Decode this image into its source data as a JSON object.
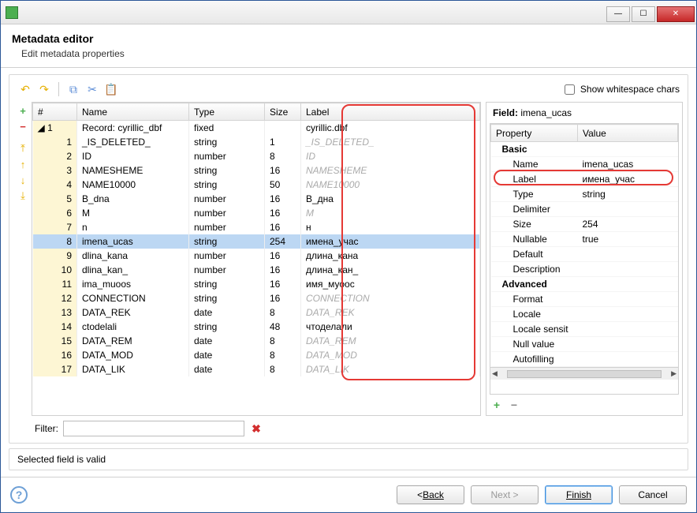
{
  "window": {
    "title": ""
  },
  "header": {
    "title": "Metadata editor",
    "subtitle": "Edit metadata properties"
  },
  "toolbar": {
    "show_ws_label": "Show whitespace chars",
    "show_ws_checked": false
  },
  "columns": {
    "idx": "#",
    "name": "Name",
    "type": "Type",
    "size": "Size",
    "label": "Label"
  },
  "rows": [
    {
      "idx": "1",
      "expander": true,
      "name": "Record: cyrillic_dbf",
      "type": "fixed",
      "size": "",
      "label": "cyrillic.dbf",
      "gray": false
    },
    {
      "idx": "1",
      "name": "_IS_DELETED_",
      "type": "string",
      "size": "1",
      "label": "_IS_DELETED_",
      "gray": true
    },
    {
      "idx": "2",
      "name": "ID",
      "type": "number",
      "size": "8",
      "label": "ID",
      "gray": true
    },
    {
      "idx": "3",
      "name": "NAMESHEME",
      "type": "string",
      "size": "16",
      "label": "NAMESHEME",
      "gray": true
    },
    {
      "idx": "4",
      "name": "NAME10000",
      "type": "string",
      "size": "50",
      "label": "NAME10000",
      "gray": true
    },
    {
      "idx": "5",
      "name": "B_dna",
      "type": "number",
      "size": "16",
      "label": "В_дна",
      "gray": false
    },
    {
      "idx": "6",
      "name": "M",
      "type": "number",
      "size": "16",
      "label": "М",
      "gray": true
    },
    {
      "idx": "7",
      "name": "n",
      "type": "number",
      "size": "16",
      "label": "н",
      "gray": false
    },
    {
      "idx": "8",
      "name": "imena_ucas",
      "type": "string",
      "size": "254",
      "label": "имена_учас",
      "gray": false,
      "selected": true
    },
    {
      "idx": "9",
      "name": "dlina_kana",
      "type": "number",
      "size": "16",
      "label": "длина_кана",
      "gray": false
    },
    {
      "idx": "10",
      "name": "dlina_kan_",
      "type": "number",
      "size": "16",
      "label": "длина_кан_",
      "gray": false
    },
    {
      "idx": "11",
      "name": "ima_muoos",
      "type": "string",
      "size": "16",
      "label": "имя_муоос",
      "gray": false
    },
    {
      "idx": "12",
      "name": "CONNECTION",
      "type": "string",
      "size": "16",
      "label": "CONNECTION",
      "gray": true
    },
    {
      "idx": "13",
      "name": "DATA_REK",
      "type": "date",
      "size": "8",
      "label": "DATA_REK",
      "gray": true
    },
    {
      "idx": "14",
      "name": "ctodelali",
      "type": "string",
      "size": "48",
      "label": "чтоделали",
      "gray": false
    },
    {
      "idx": "15",
      "name": "DATA_REM",
      "type": "date",
      "size": "8",
      "label": "DATA_REM",
      "gray": true
    },
    {
      "idx": "16",
      "name": "DATA_MOD",
      "type": "date",
      "size": "8",
      "label": "DATA_MOD",
      "gray": true
    },
    {
      "idx": "17",
      "name": "DATA_LIK",
      "type": "date",
      "size": "8",
      "label": "DATA_LIK",
      "gray": true
    }
  ],
  "filter": {
    "label": "Filter:",
    "value": ""
  },
  "right": {
    "title_prefix": "Field:",
    "title_name": "imena_ucas",
    "col_property": "Property",
    "col_value": "Value",
    "groups": [
      {
        "group": "Basic"
      },
      {
        "name": "Name",
        "value": "imena_ucas"
      },
      {
        "name": "Label",
        "value": "имена_учас",
        "highlight": true
      },
      {
        "name": "Type",
        "value": "string"
      },
      {
        "name": "Delimiter",
        "value": ""
      },
      {
        "name": "Size",
        "value": "254"
      },
      {
        "name": "Nullable",
        "value": "true"
      },
      {
        "name": "Default",
        "value": ""
      },
      {
        "name": "Description",
        "value": ""
      },
      {
        "group": "Advanced"
      },
      {
        "name": "Format",
        "value": ""
      },
      {
        "name": "Locale",
        "value": ""
      },
      {
        "name": "Locale sensit",
        "value": ""
      },
      {
        "name": "Null value",
        "value": ""
      },
      {
        "name": "Autofilling",
        "value": ""
      }
    ]
  },
  "status": {
    "text": "Selected field is valid"
  },
  "footer": {
    "back": "Back",
    "next": "Next >",
    "finish": "Finish",
    "cancel": "Cancel"
  }
}
